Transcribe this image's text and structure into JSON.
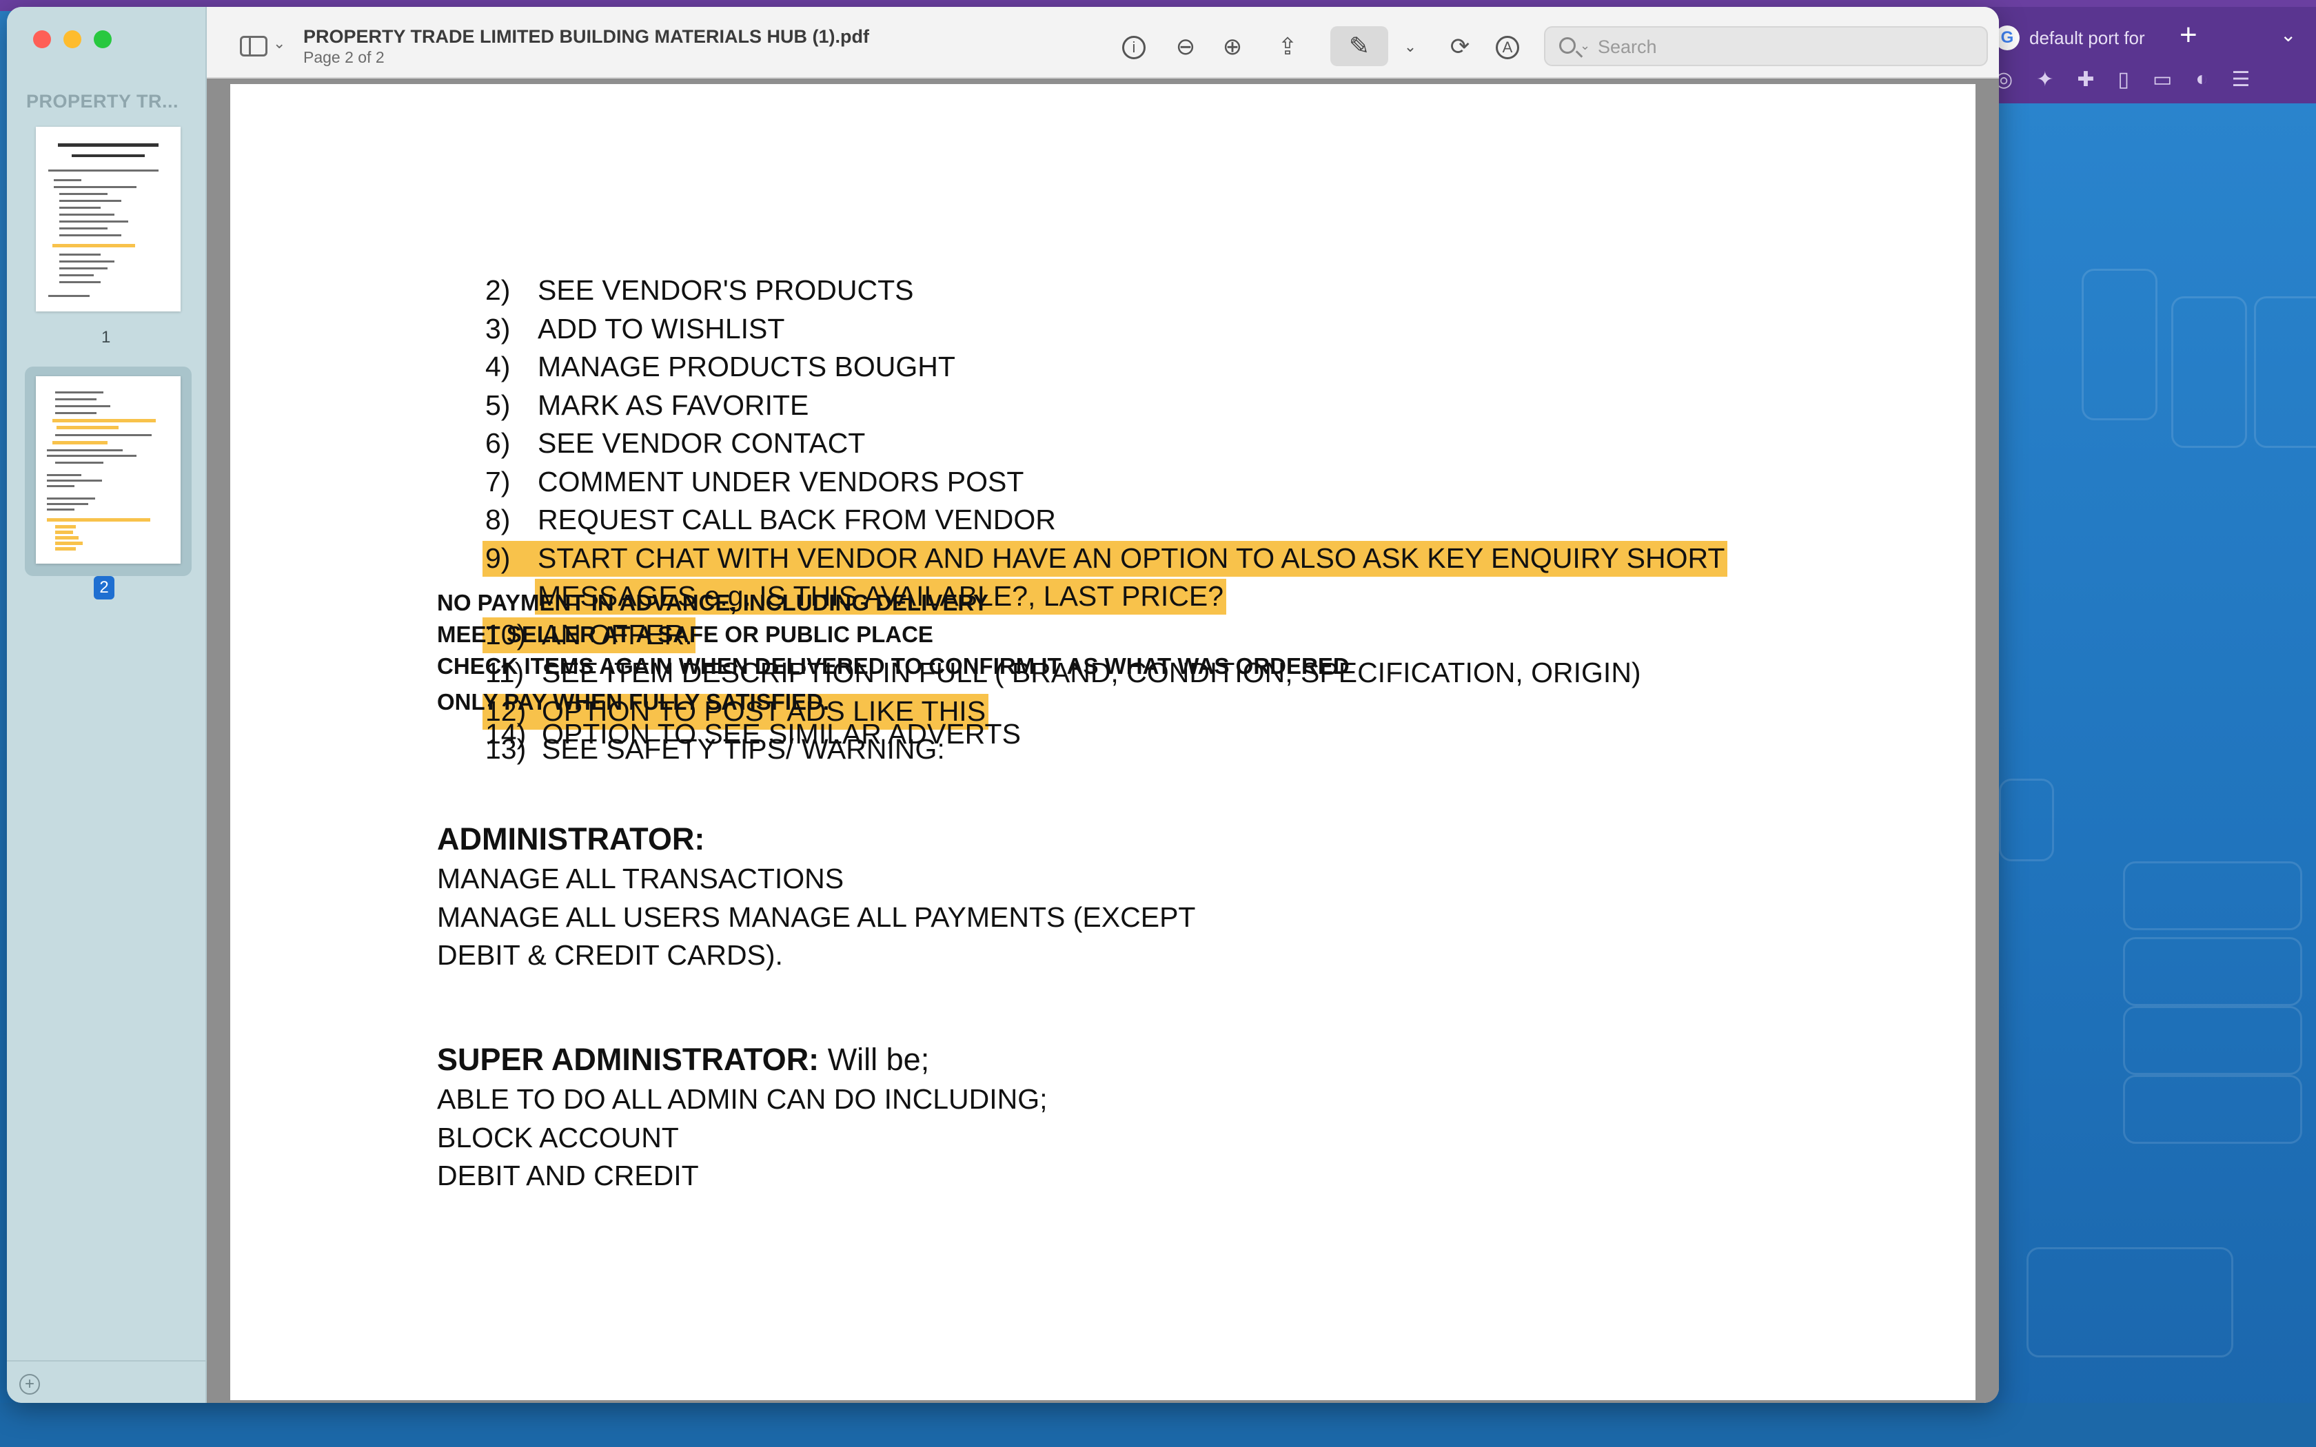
{
  "window": {
    "title": "PROPERTY TRADE LIMITED BUILDING MATERIALS HUB (1).pdf",
    "subtitle": "Page 2 of 2"
  },
  "sidebar": {
    "title": "PROPERTY TR...",
    "pages": [
      {
        "label": "1",
        "selected": false
      },
      {
        "label": "2",
        "selected": true
      }
    ]
  },
  "toolbar": {
    "icons": [
      "sidebar-toggle-icon",
      "info-icon",
      "zoom-out-icon",
      "zoom-in-icon",
      "share-icon",
      "markup-pen-icon",
      "chevron-down-icon",
      "rotate-icon",
      "annotate-icon"
    ],
    "search_placeholder": "Search",
    "search_value": ""
  },
  "background_browser": {
    "tab_title": "default port for",
    "accent": "#5a3590"
  },
  "highlight_color": "#f8c24b",
  "document": {
    "list_items": [
      {
        "num": "2)",
        "text": "SEE VENDOR'S PRODUCTS",
        "highlight": false
      },
      {
        "num": "3)",
        "text": "ADD TO WISHLIST",
        "highlight": false
      },
      {
        "num": "4)",
        "text": "MANAGE PRODUCTS BOUGHT",
        "highlight": false
      },
      {
        "num": "5)",
        "text": "MARK AS FAVORITE",
        "highlight": false
      },
      {
        "num": "6)",
        "text": "SEE VENDOR CONTACT",
        "highlight": false
      },
      {
        "num": "7)",
        "text": "COMMENT UNDER VENDORS POST",
        "highlight": false
      },
      {
        "num": "8)",
        "text": "REQUEST CALL BACK FROM VENDOR",
        "highlight": false
      },
      {
        "num": "9)",
        "text": "START CHAT WITH VENDOR AND HAVE AN OPTION TO ALSO ASK KEY ENQUIRY SHORT",
        "highlight": true
      },
      {
        "num": "",
        "text": "MESSAGES e.g. IS THIS AVAILABLE?, LAST PRICE?",
        "highlight": true
      },
      {
        "num": "10)",
        "text": "AN OFFER.",
        "highlight": true
      },
      {
        "num": "11)",
        "text": "SEE ITEM DESCRIPTION IN FULL ( BRAND, CONDITION, SPECIFICATION, ORIGIN)",
        "highlight": false
      },
      {
        "num": "12)",
        "text": "OPTION TO POST ADS LIKE THIS",
        "highlight": true
      },
      {
        "num": "13)",
        "text": "SEE SAFETY TIPS/ WARNING:",
        "highlight": false
      }
    ],
    "safety_tips": [
      "NO PAYMENT IN ADVANCE, INCLUDING DELIVERY",
      "MEET SELLER AT A SAFE OR PUBLIC PLACE",
      "CHECK ITEMS AGAIN WHEN DELIVERED TO CONFIRM IT AS WHAT WAS ORDERED",
      "ONLY PAY WHEN FULLY SATISFIED."
    ],
    "last_item": {
      "num": "14)",
      "text": "OPTION TO SEE SIMILAR ADVERTS"
    },
    "admin": {
      "heading": "ADMINISTRATOR:",
      "lines": [
        "MANAGE ALL TRANSACTIONS",
        "MANAGE ALL USERS MANAGE ALL PAYMENTS (EXCEPT",
        "DEBIT & CREDIT CARDS)."
      ]
    },
    "super_admin": {
      "heading": "SUPER ADMINISTRATOR:",
      "heading_suffix": " Will be;",
      "lines": [
        "ABLE TO DO ALL ADMIN CAN DO INCLUDING;",
        "BLOCK ACCOUNT",
        "DEBIT AND CREDIT"
      ]
    }
  }
}
